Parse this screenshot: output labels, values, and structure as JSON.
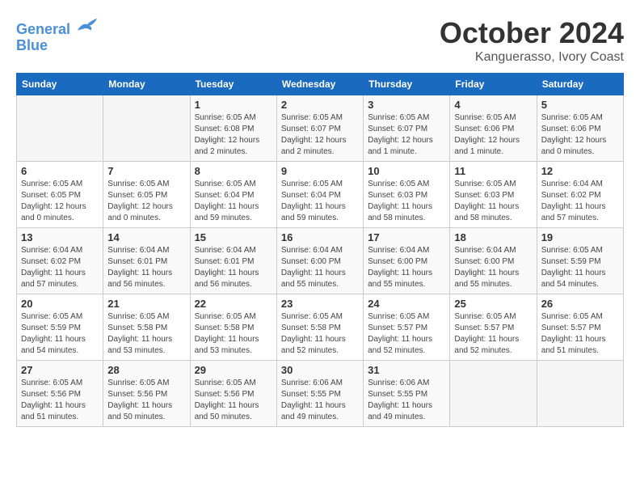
{
  "header": {
    "logo_line1": "General",
    "logo_line2": "Blue",
    "month": "October 2024",
    "location": "Kanguerasso, Ivory Coast"
  },
  "weekdays": [
    "Sunday",
    "Monday",
    "Tuesday",
    "Wednesday",
    "Thursday",
    "Friday",
    "Saturday"
  ],
  "weeks": [
    [
      {
        "day": "",
        "info": ""
      },
      {
        "day": "",
        "info": ""
      },
      {
        "day": "1",
        "info": "Sunrise: 6:05 AM\nSunset: 6:08 PM\nDaylight: 12 hours\nand 2 minutes."
      },
      {
        "day": "2",
        "info": "Sunrise: 6:05 AM\nSunset: 6:07 PM\nDaylight: 12 hours\nand 2 minutes."
      },
      {
        "day": "3",
        "info": "Sunrise: 6:05 AM\nSunset: 6:07 PM\nDaylight: 12 hours\nand 1 minute."
      },
      {
        "day": "4",
        "info": "Sunrise: 6:05 AM\nSunset: 6:06 PM\nDaylight: 12 hours\nand 1 minute."
      },
      {
        "day": "5",
        "info": "Sunrise: 6:05 AM\nSunset: 6:06 PM\nDaylight: 12 hours\nand 0 minutes."
      }
    ],
    [
      {
        "day": "6",
        "info": "Sunrise: 6:05 AM\nSunset: 6:05 PM\nDaylight: 12 hours\nand 0 minutes."
      },
      {
        "day": "7",
        "info": "Sunrise: 6:05 AM\nSunset: 6:05 PM\nDaylight: 12 hours\nand 0 minutes."
      },
      {
        "day": "8",
        "info": "Sunrise: 6:05 AM\nSunset: 6:04 PM\nDaylight: 11 hours\nand 59 minutes."
      },
      {
        "day": "9",
        "info": "Sunrise: 6:05 AM\nSunset: 6:04 PM\nDaylight: 11 hours\nand 59 minutes."
      },
      {
        "day": "10",
        "info": "Sunrise: 6:05 AM\nSunset: 6:03 PM\nDaylight: 11 hours\nand 58 minutes."
      },
      {
        "day": "11",
        "info": "Sunrise: 6:05 AM\nSunset: 6:03 PM\nDaylight: 11 hours\nand 58 minutes."
      },
      {
        "day": "12",
        "info": "Sunrise: 6:04 AM\nSunset: 6:02 PM\nDaylight: 11 hours\nand 57 minutes."
      }
    ],
    [
      {
        "day": "13",
        "info": "Sunrise: 6:04 AM\nSunset: 6:02 PM\nDaylight: 11 hours\nand 57 minutes."
      },
      {
        "day": "14",
        "info": "Sunrise: 6:04 AM\nSunset: 6:01 PM\nDaylight: 11 hours\nand 56 minutes."
      },
      {
        "day": "15",
        "info": "Sunrise: 6:04 AM\nSunset: 6:01 PM\nDaylight: 11 hours\nand 56 minutes."
      },
      {
        "day": "16",
        "info": "Sunrise: 6:04 AM\nSunset: 6:00 PM\nDaylight: 11 hours\nand 55 minutes."
      },
      {
        "day": "17",
        "info": "Sunrise: 6:04 AM\nSunset: 6:00 PM\nDaylight: 11 hours\nand 55 minutes."
      },
      {
        "day": "18",
        "info": "Sunrise: 6:04 AM\nSunset: 6:00 PM\nDaylight: 11 hours\nand 55 minutes."
      },
      {
        "day": "19",
        "info": "Sunrise: 6:05 AM\nSunset: 5:59 PM\nDaylight: 11 hours\nand 54 minutes."
      }
    ],
    [
      {
        "day": "20",
        "info": "Sunrise: 6:05 AM\nSunset: 5:59 PM\nDaylight: 11 hours\nand 54 minutes."
      },
      {
        "day": "21",
        "info": "Sunrise: 6:05 AM\nSunset: 5:58 PM\nDaylight: 11 hours\nand 53 minutes."
      },
      {
        "day": "22",
        "info": "Sunrise: 6:05 AM\nSunset: 5:58 PM\nDaylight: 11 hours\nand 53 minutes."
      },
      {
        "day": "23",
        "info": "Sunrise: 6:05 AM\nSunset: 5:58 PM\nDaylight: 11 hours\nand 52 minutes."
      },
      {
        "day": "24",
        "info": "Sunrise: 6:05 AM\nSunset: 5:57 PM\nDaylight: 11 hours\nand 52 minutes."
      },
      {
        "day": "25",
        "info": "Sunrise: 6:05 AM\nSunset: 5:57 PM\nDaylight: 11 hours\nand 52 minutes."
      },
      {
        "day": "26",
        "info": "Sunrise: 6:05 AM\nSunset: 5:57 PM\nDaylight: 11 hours\nand 51 minutes."
      }
    ],
    [
      {
        "day": "27",
        "info": "Sunrise: 6:05 AM\nSunset: 5:56 PM\nDaylight: 11 hours\nand 51 minutes."
      },
      {
        "day": "28",
        "info": "Sunrise: 6:05 AM\nSunset: 5:56 PM\nDaylight: 11 hours\nand 50 minutes."
      },
      {
        "day": "29",
        "info": "Sunrise: 6:05 AM\nSunset: 5:56 PM\nDaylight: 11 hours\nand 50 minutes."
      },
      {
        "day": "30",
        "info": "Sunrise: 6:06 AM\nSunset: 5:55 PM\nDaylight: 11 hours\nand 49 minutes."
      },
      {
        "day": "31",
        "info": "Sunrise: 6:06 AM\nSunset: 5:55 PM\nDaylight: 11 hours\nand 49 minutes."
      },
      {
        "day": "",
        "info": ""
      },
      {
        "day": "",
        "info": ""
      }
    ]
  ]
}
